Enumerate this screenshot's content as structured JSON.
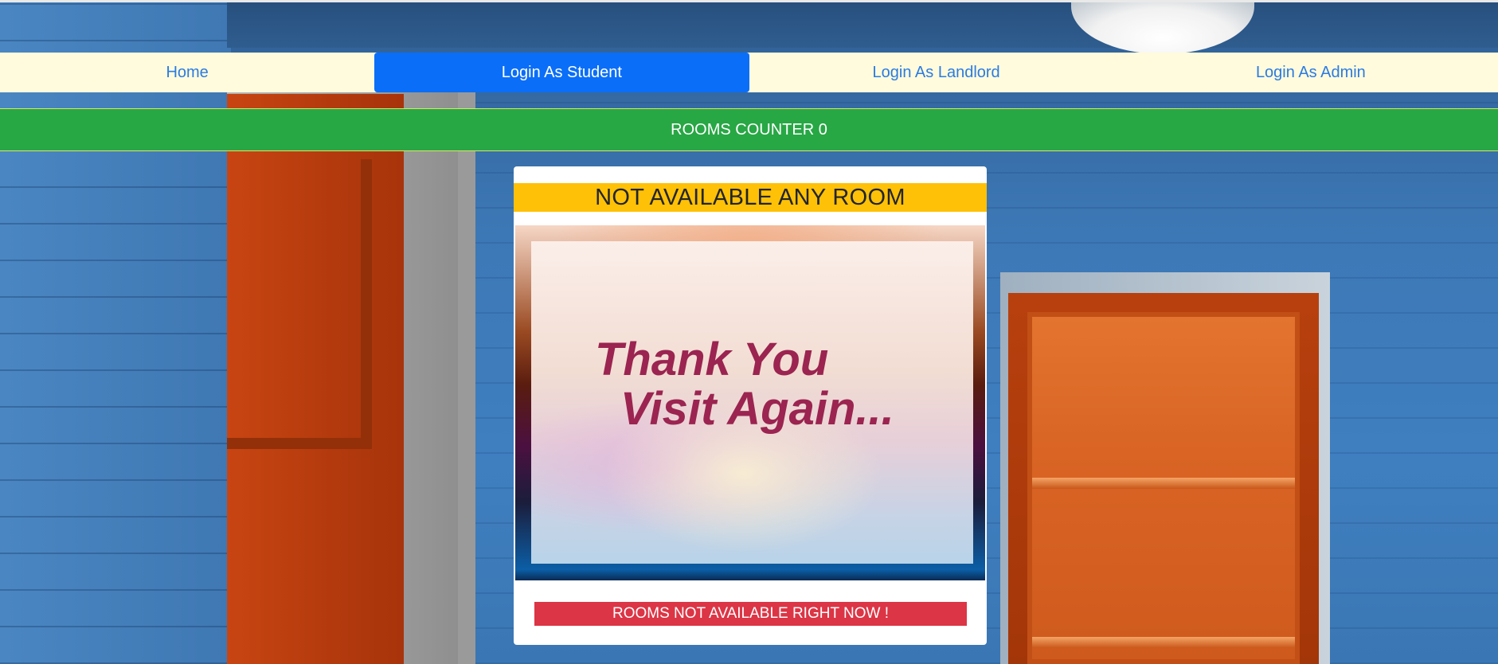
{
  "nav": {
    "items": [
      {
        "label": "Home",
        "active": false
      },
      {
        "label": "Login As Student",
        "active": true
      },
      {
        "label": "Login As Landlord",
        "active": false
      },
      {
        "label": "Login As Admin",
        "active": false
      }
    ]
  },
  "counter": {
    "text": "ROOMS COUNTER 0"
  },
  "card": {
    "title": "NOT AVAILABLE ANY ROOM",
    "image_text_line1": "Thank You",
    "image_text_line2": "Visit Again...",
    "notice": "ROOMS NOT AVAILABLE RIGHT NOW !"
  },
  "colors": {
    "nav_bg": "#fffbdc",
    "nav_link": "#2b7be3",
    "nav_active": "#0a6ef8",
    "counter_bg": "#28a745",
    "title_bg": "#ffc107",
    "notice_bg": "#dc3545",
    "thank_you_text": "#9b2450"
  }
}
